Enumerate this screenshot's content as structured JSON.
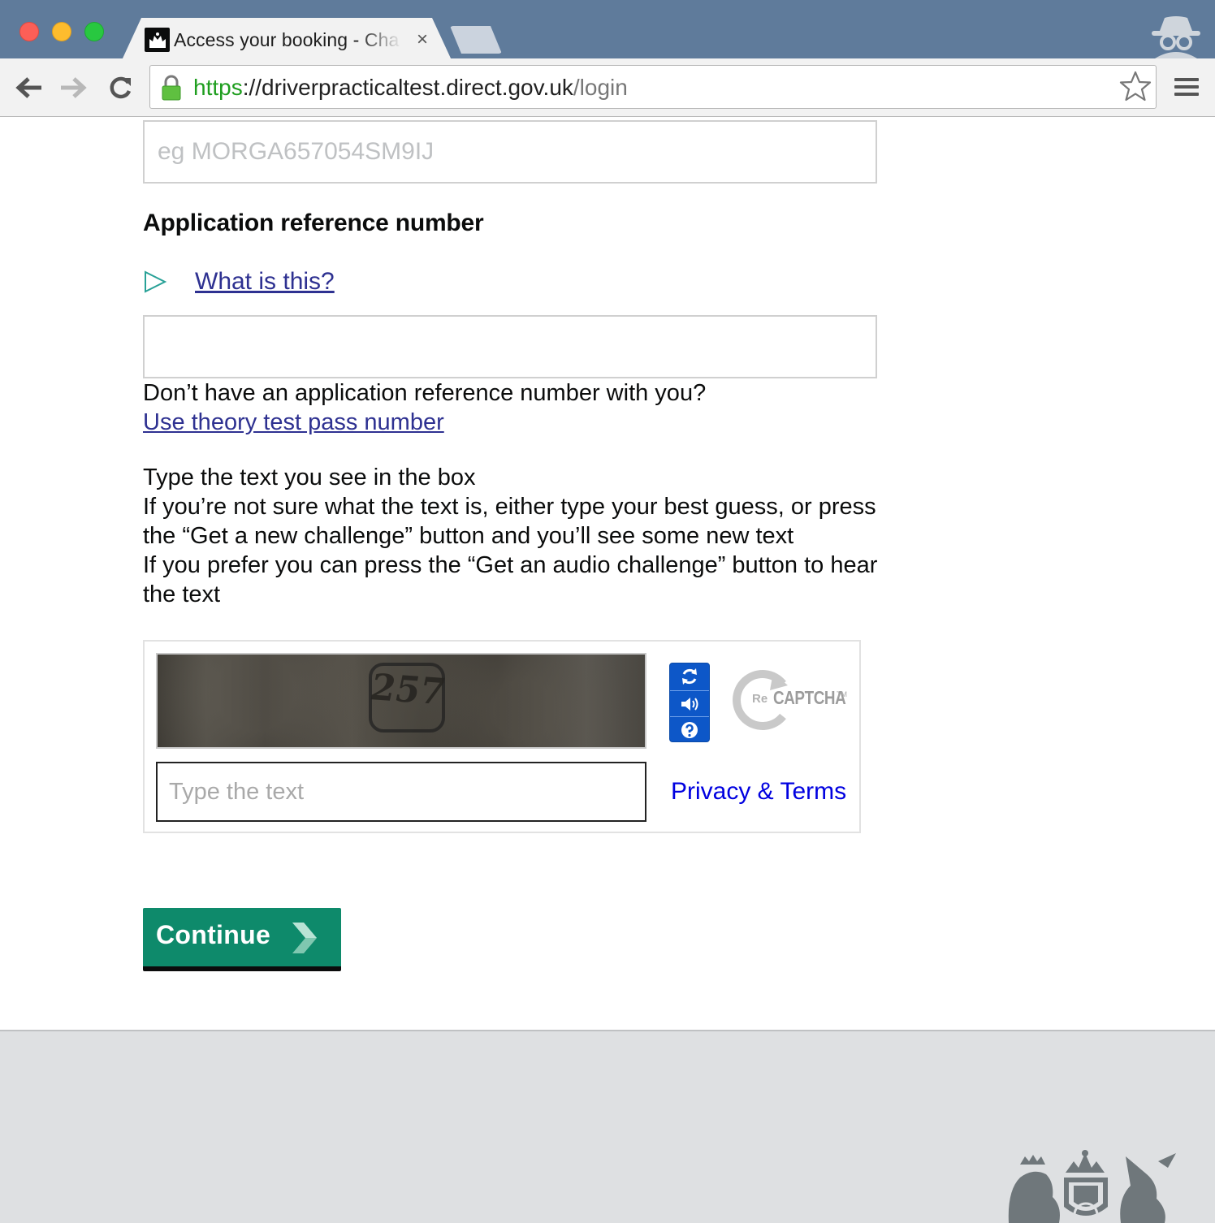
{
  "browser": {
    "tab_title": "Access your booking - Cha",
    "tab_close": "×",
    "url": {
      "scheme": "https",
      "separator": "://",
      "host": "driverpracticaltest.direct.gov.uk",
      "path": "/login"
    }
  },
  "form": {
    "driver_licence_placeholder": "eg MORGA657054SM9IJ",
    "app_ref_label": "Application reference number",
    "what_is_this": "What is this?",
    "app_ref_value": "",
    "no_ref_text": "Don’t have an application reference number with you?",
    "theory_link": "Use theory test pass number",
    "captcha_instructions": {
      "line1": "Type the text you see in the box",
      "line2": "If you’re not sure what the text is, either type your best guess, or press the “Get a new challenge” button and you’ll see some new text",
      "line3": "If you prefer you can press the “Get an audio challenge” button to hear the text"
    },
    "continue_label": "Continue"
  },
  "captcha": {
    "image_text": "257",
    "input_placeholder": "Type the text",
    "input_value": "",
    "logo_prefix": "Re",
    "logo_word": "CAPTCHA",
    "logo_tm": "TM",
    "privacy_link": "Privacy & Terms"
  },
  "colors": {
    "link": "#2e3191",
    "button_green": "#0e8a6b",
    "captcha_blue": "#0d57c8",
    "footer_bg": "#dee0e2"
  }
}
